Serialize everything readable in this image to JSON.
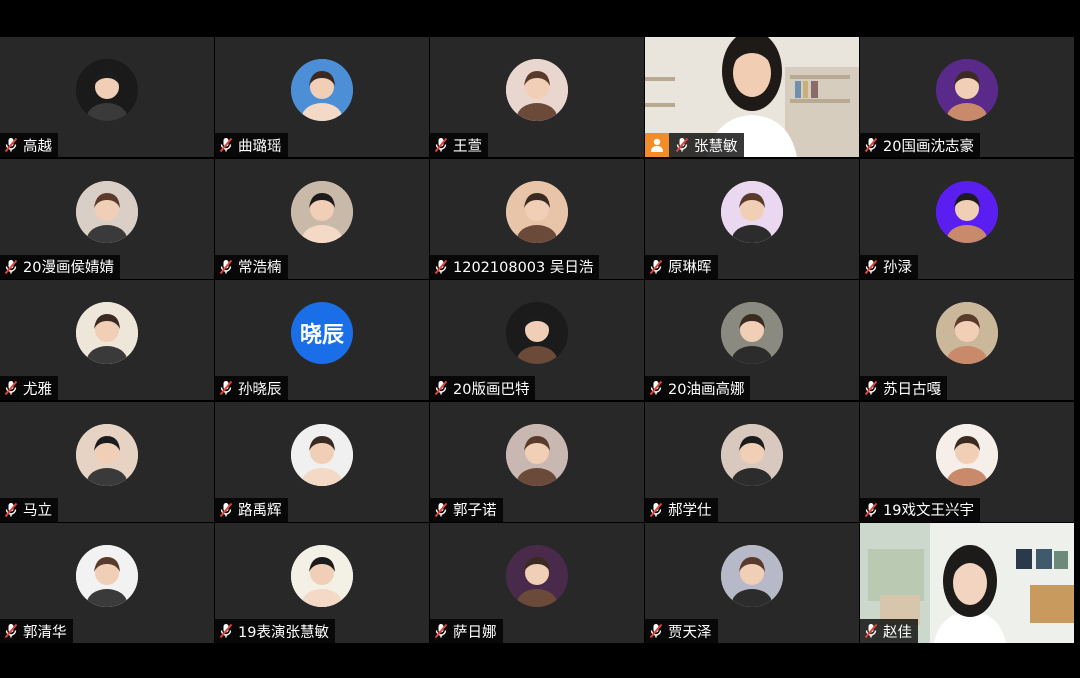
{
  "meeting": {
    "participants": [
      {
        "name": "高越",
        "avatar_icon": "dark-portrait-avatar-icon",
        "avatar_color": "#1a1a1a"
      },
      {
        "name": "曲璐瑶",
        "avatar_icon": "outdoor-lake-avatar-icon",
        "avatar_color": "#4c8fd6"
      },
      {
        "name": "王萱",
        "avatar_icon": "bunny-ears-avatar-icon",
        "avatar_color": "#e9d6cf"
      },
      {
        "name": "张慧敏",
        "video": true,
        "host": true,
        "host_icon": "person-host-icon"
      },
      {
        "name": "20国画沈志豪",
        "avatar_icon": "purple-hood-avatar-icon",
        "avatar_color": "#5a2a8a"
      },
      {
        "name": "20漫画侯婧婧",
        "avatar_icon": "couple-photo-avatar-icon",
        "avatar_color": "#d9cfc6"
      },
      {
        "name": "常浩楠",
        "avatar_icon": "masked-cap-avatar-icon",
        "avatar_color": "#c9b9a8"
      },
      {
        "name": "1202108003 吴日浩",
        "avatar_icon": "child-smile-avatar-icon",
        "avatar_color": "#e8c4a8"
      },
      {
        "name": "原琳晖",
        "avatar_icon": "cartoon-character-avatar-icon",
        "avatar_color": "#e9d8f0"
      },
      {
        "name": "孙渌",
        "avatar_icon": "solid-purple-avatar-icon",
        "avatar_color": "#5a1ff0"
      },
      {
        "name": "尤雅",
        "avatar_icon": "wide-hat-drawing-avatar-icon",
        "avatar_color": "#efe6da"
      },
      {
        "name": "孙晓辰",
        "avatar_text": "晓辰",
        "avatar_color": "#1a6fe8"
      },
      {
        "name": "20版画巴特",
        "avatar_icon": "anime-glasses-avatar-icon",
        "avatar_color": "#1b1b1b"
      },
      {
        "name": "20油画高娜",
        "avatar_icon": "girl-mirror-avatar-icon",
        "avatar_color": "#8a8a80"
      },
      {
        "name": "苏日古嘎",
        "avatar_icon": "girl-sitting-avatar-icon",
        "avatar_color": "#cbb79a"
      },
      {
        "name": "马立",
        "avatar_icon": "girl-peace-avatar-icon",
        "avatar_color": "#e6d3c4"
      },
      {
        "name": "路禹辉",
        "avatar_icon": "sketch-man-avatar-icon",
        "avatar_color": "#f0f0f0"
      },
      {
        "name": "郭子诺",
        "avatar_icon": "girl-dark-hair-avatar-icon",
        "avatar_color": "#c9b8b2"
      },
      {
        "name": "郝学仕",
        "avatar_icon": "girl-hand-face-avatar-icon",
        "avatar_color": "#d8c8be"
      },
      {
        "name": "19戏文王兴宇",
        "avatar_icon": "cute-girl-drawing-avatar-icon",
        "avatar_color": "#f6eee8"
      },
      {
        "name": "郭清华",
        "avatar_icon": "girl-white-dress-avatar-icon",
        "avatar_color": "#f2f2f2"
      },
      {
        "name": "19表演张慧敏",
        "avatar_icon": "emoji-faces-avatar-icon",
        "avatar_color": "#f3f0e6"
      },
      {
        "name": "萨日娜",
        "avatar_icon": "anime-red-hair-avatar-icon",
        "avatar_color": "#4a2a4a"
      },
      {
        "name": "贾天泽",
        "avatar_icon": "castle-sky-avatar-icon",
        "avatar_color": "#b8b9c8"
      },
      {
        "name": "赵佳",
        "video": true
      }
    ]
  },
  "icons": {
    "muted_mic": "muted-microphone-icon"
  },
  "colors": {
    "tile_bg": "#282828",
    "page_bg": "#000000",
    "host_badge": "#f28c28",
    "muted_red": "#e0443a"
  }
}
